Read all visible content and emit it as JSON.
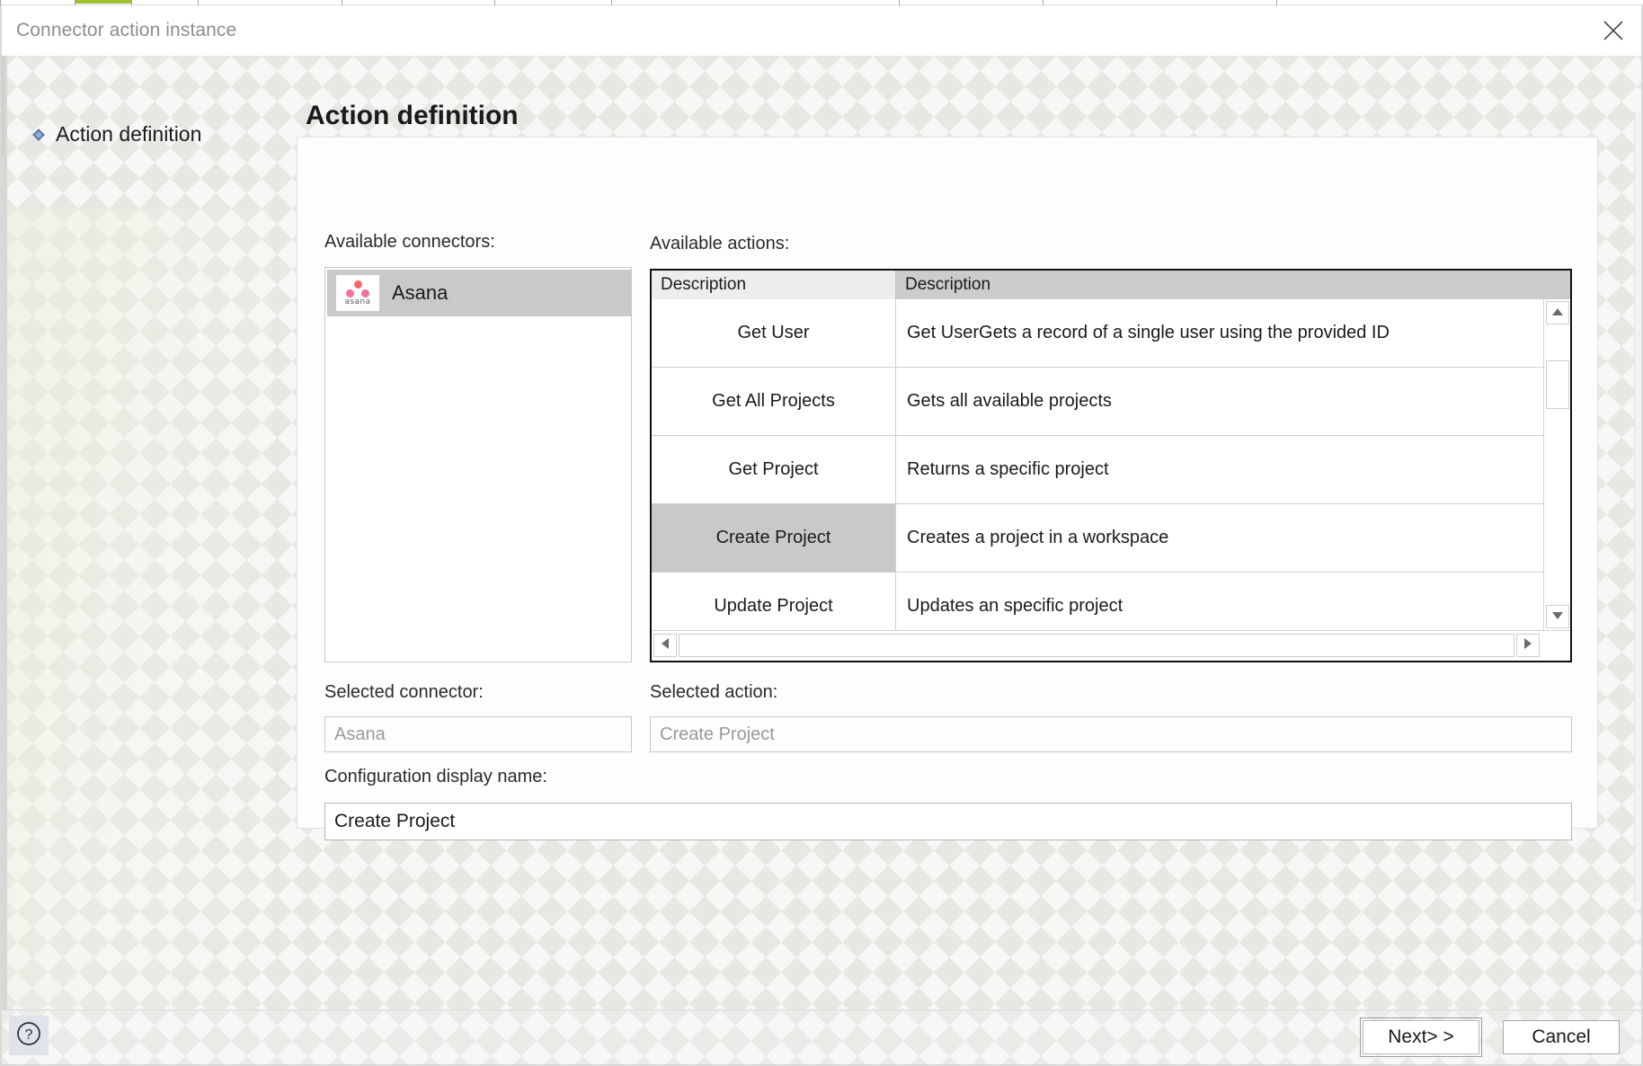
{
  "window": {
    "title": "Connector action instance",
    "close_icon": "close-icon"
  },
  "wizard": {
    "steps": [
      {
        "label": "Action definition",
        "bullet_icon": "step-bullet-icon",
        "active": true
      }
    ]
  },
  "panel": {
    "heading": "Action definition",
    "labels": {
      "available_connectors": "Available connectors:",
      "available_actions": "Available actions:",
      "selected_connector": "Selected connector:",
      "selected_action": "Selected action:",
      "configuration_display_name": "Configuration display name:"
    },
    "connectors": [
      {
        "name": "Asana",
        "logo_icon": "asana-logo-icon",
        "logo_word": "asana",
        "selected": true
      }
    ],
    "actions_grid": {
      "columns": [
        "Description",
        "Description"
      ],
      "rows": [
        {
          "name": "Get User",
          "description": "Get UserGets a record of a single user using the provided ID",
          "selected": false
        },
        {
          "name": "Get All Projects",
          "description": "Gets all available projects",
          "selected": false
        },
        {
          "name": "Get Project",
          "description": "Returns a specific project",
          "selected": false
        },
        {
          "name": "Create Project",
          "description": "Creates a project in a workspace",
          "selected": true
        },
        {
          "name": "Update Project",
          "description": "Updates an specific project",
          "selected": false
        }
      ]
    },
    "selected_connector_value": "Asana",
    "selected_action_value": "Create Project",
    "configuration_display_name_value": "Create Project"
  },
  "footer": {
    "help_icon": "help-icon",
    "next_label": "Next> >",
    "cancel_label": "Cancel"
  },
  "colors": {
    "accent_green": "#9fbf32",
    "selection_gray": "#c9c9c9",
    "header_gray": "#cccccc",
    "asana_coral": "#f06a6a",
    "asana_pink": "#f2709c",
    "title_gray": "#8d8d8d"
  }
}
